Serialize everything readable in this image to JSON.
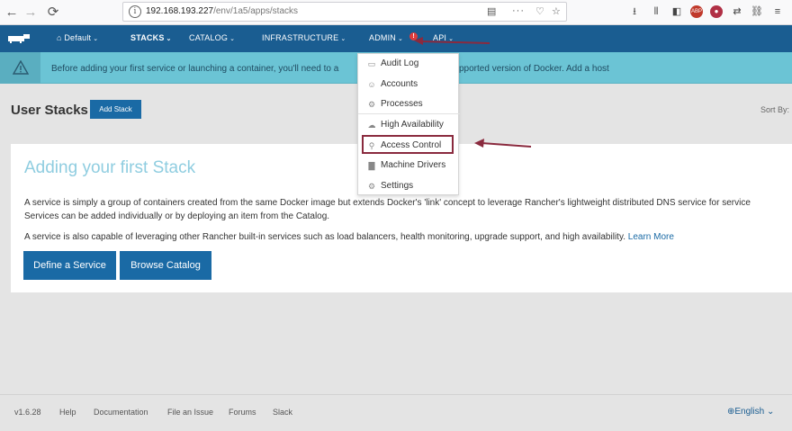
{
  "browser": {
    "url_host": "192.168.193.227",
    "url_path": "/env/1a5/apps/stacks",
    "back_glyph": "←",
    "forward_glyph": "→",
    "reload_glyph": "⟳",
    "more_glyph": "···"
  },
  "header": {
    "env_label": "Default",
    "nav": {
      "stacks": "STACKS",
      "catalog": "CATALOG",
      "infrastructure": "INFRASTRUCTURE",
      "admin": "ADMIN",
      "api": "API"
    },
    "admin_alert": "!"
  },
  "banner": {
    "text_before": "Before adding your first service or launching a container, you'll need to a",
    "text_after": "pported version of Docker.",
    "link": "Add a host"
  },
  "page": {
    "title": "User Stacks",
    "add_button": "Add Stack",
    "sort_label": "Sort By:"
  },
  "card": {
    "title": "Adding your first Stack",
    "p1_line1": "A service is simply a group of containers created from the same Docker image but extends Docker's 'link' concept to leverage Rancher's lightweight distributed DNS service for service",
    "p1_line2": "Services can be added individually or by deploying an item from the Catalog.",
    "p2": "A service is also capable of leveraging other Rancher built-in services such as load balancers, health monitoring, upgrade support, and high availability.",
    "p2_link": "Learn More",
    "define_button": "Define a Service",
    "browse_button": "Browse Catalog"
  },
  "admin_menu": {
    "items": [
      {
        "label": "Audit Log",
        "icon": "audit-log-icon"
      },
      {
        "label": "Accounts",
        "icon": "accounts-icon"
      },
      {
        "label": "Processes",
        "icon": "processes-icon"
      },
      {
        "label": "High Availability",
        "icon": "high-availability-icon"
      },
      {
        "label": "Access Control",
        "icon": "access-control-icon"
      },
      {
        "label": "Machine Drivers",
        "icon": "machine-drivers-icon"
      },
      {
        "label": "Settings",
        "icon": "settings-icon"
      }
    ]
  },
  "footer": {
    "version": "v1.6.28",
    "help": "Help",
    "documentation": "Documentation",
    "file_issue": "File an Issue",
    "forums": "Forums",
    "slack": "Slack",
    "language": "English"
  },
  "colors": {
    "header": "#1a5d91",
    "banner": "#6bc4d5",
    "primary_button": "#1a6aa5",
    "annotation": "#8a2a3e"
  }
}
